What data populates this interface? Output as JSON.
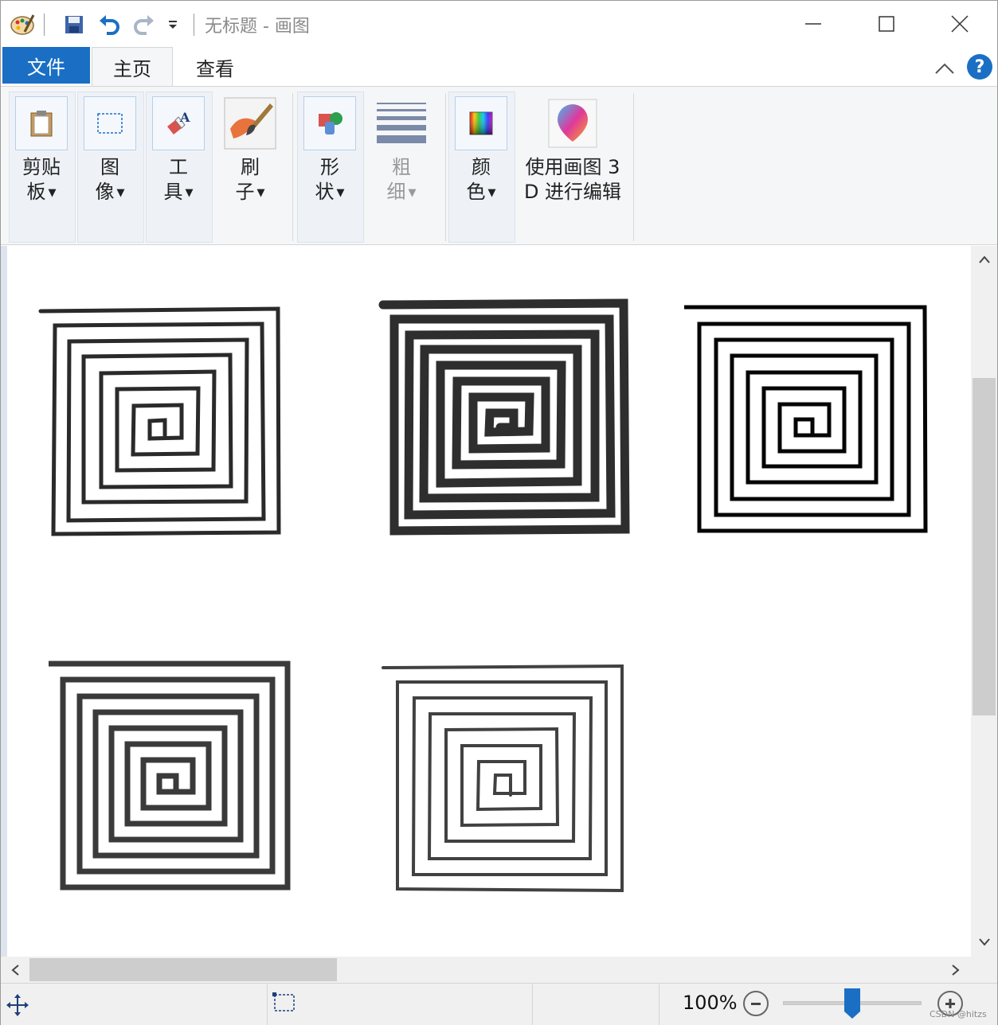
{
  "window": {
    "title": "无标题 - 画图",
    "minimize_icon": "minimize-icon",
    "maximize_icon": "maximize-icon",
    "close_icon": "close-icon"
  },
  "quick_access": {
    "app_icon": "paint-palette-icon",
    "save_icon": "save-icon",
    "undo_icon": "undo-icon",
    "redo_icon": "redo-icon",
    "customize_icon": "dropdown-arrow-icon"
  },
  "tabs": [
    {
      "label": "文件"
    },
    {
      "label": "主页"
    },
    {
      "label": "查看"
    }
  ],
  "ribbon": {
    "collapse_icon": "chevron-up-icon",
    "help_label": "?",
    "groups": [
      {
        "line1": "剪贴",
        "line2": "板",
        "icon": "clipboard-icon"
      },
      {
        "line1": "图",
        "line2": "像",
        "icon": "select-rectangle-icon"
      },
      {
        "line1": "工",
        "line2": "具",
        "icon": "tools-icon"
      },
      {
        "line1": "刷",
        "line2": "子",
        "icon": "brush-icon"
      },
      {
        "line1": "形",
        "line2": "状",
        "icon": "shapes-icon"
      },
      {
        "line1": "粗",
        "line2": "细",
        "icon": "line-size-icon",
        "disabled": true
      },
      {
        "line1": "颜",
        "line2": "色",
        "icon": "color-palette-icon"
      },
      {
        "line1": "使用画图 3",
        "line2": "D 进行编辑",
        "icon": "paint3d-icon"
      }
    ],
    "accent_color": "#1a6fc4"
  },
  "status": {
    "move_icon": "move-cursor-icon",
    "selection_icon": "selection-size-icon",
    "zoom": "100%",
    "zoom_fraction": 0.5,
    "watermark": "CSDN @hitzs"
  }
}
